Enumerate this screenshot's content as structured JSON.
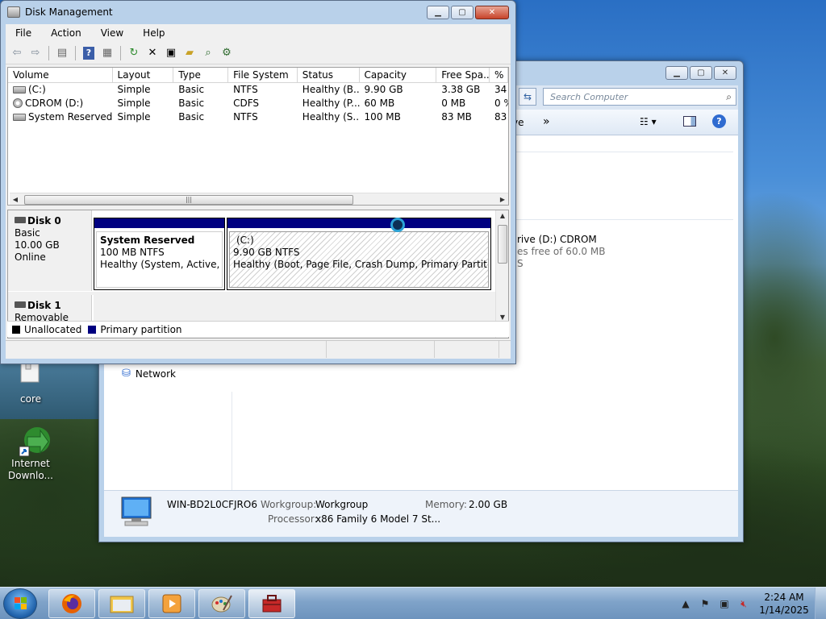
{
  "desktop": {
    "icons": [
      {
        "label": "core"
      },
      {
        "label": "Internet Downlo..."
      }
    ]
  },
  "explorer": {
    "search_placeholder": "Search Computer",
    "toolbar_partial": "ve",
    "more_chevron": "»",
    "drive_text": "rive (D:) CDROM",
    "drive_free": "es free of 60.0 MB",
    "drive_extra": "S",
    "nav_network": "Network",
    "details": {
      "computer_name": "WIN-BD2L0CFJRO6",
      "workgroup_label": "Workgroup:",
      "workgroup_value": "Workgroup",
      "memory_label": "Memory:",
      "memory_value": "2.00 GB",
      "processor_label": "Processor:",
      "processor_value": "x86 Family 6 Model 7 St..."
    }
  },
  "dm": {
    "title": "Disk Management",
    "menu": [
      "File",
      "Action",
      "View",
      "Help"
    ],
    "columns": [
      "Volume",
      "Layout",
      "Type",
      "File System",
      "Status",
      "Capacity",
      "Free Spa...",
      "% F"
    ],
    "rows": [
      {
        "volume": "(C:)",
        "layout": "Simple",
        "type": "Basic",
        "fs": "NTFS",
        "status": "Healthy (B...",
        "capacity": "9.90 GB",
        "free": "3.38 GB",
        "pct": "34"
      },
      {
        "volume": "CDROM (D:)",
        "layout": "Simple",
        "type": "Basic",
        "fs": "CDFS",
        "status": "Healthy (P...",
        "capacity": "60 MB",
        "free": "0 MB",
        "pct": "0 %"
      },
      {
        "volume": "System Reserved",
        "layout": "Simple",
        "type": "Basic",
        "fs": "NTFS",
        "status": "Healthy (S...",
        "capacity": "100 MB",
        "free": "83 MB",
        "pct": "83"
      }
    ],
    "disk0": {
      "name": "Disk 0",
      "type": "Basic",
      "size": "10.00 GB",
      "state": "Online",
      "partitions": [
        {
          "name": "System Reserved",
          "size": "100 MB NTFS",
          "status": "Healthy (System, Active, Prir"
        },
        {
          "name": "(C:)",
          "size": "9.90 GB NTFS",
          "status": "Healthy (Boot, Page File, Crash Dump, Primary Partition)"
        }
      ]
    },
    "disk1": {
      "name": "Disk 1",
      "type": "Removable (E:)"
    },
    "legend": {
      "unallocated": "Unallocated",
      "primary": "Primary partition",
      "unallocated_color": "#000000",
      "primary_color": "#000080"
    }
  },
  "taskbar": {
    "time": "2:24 AM",
    "date": "1/14/2025"
  }
}
